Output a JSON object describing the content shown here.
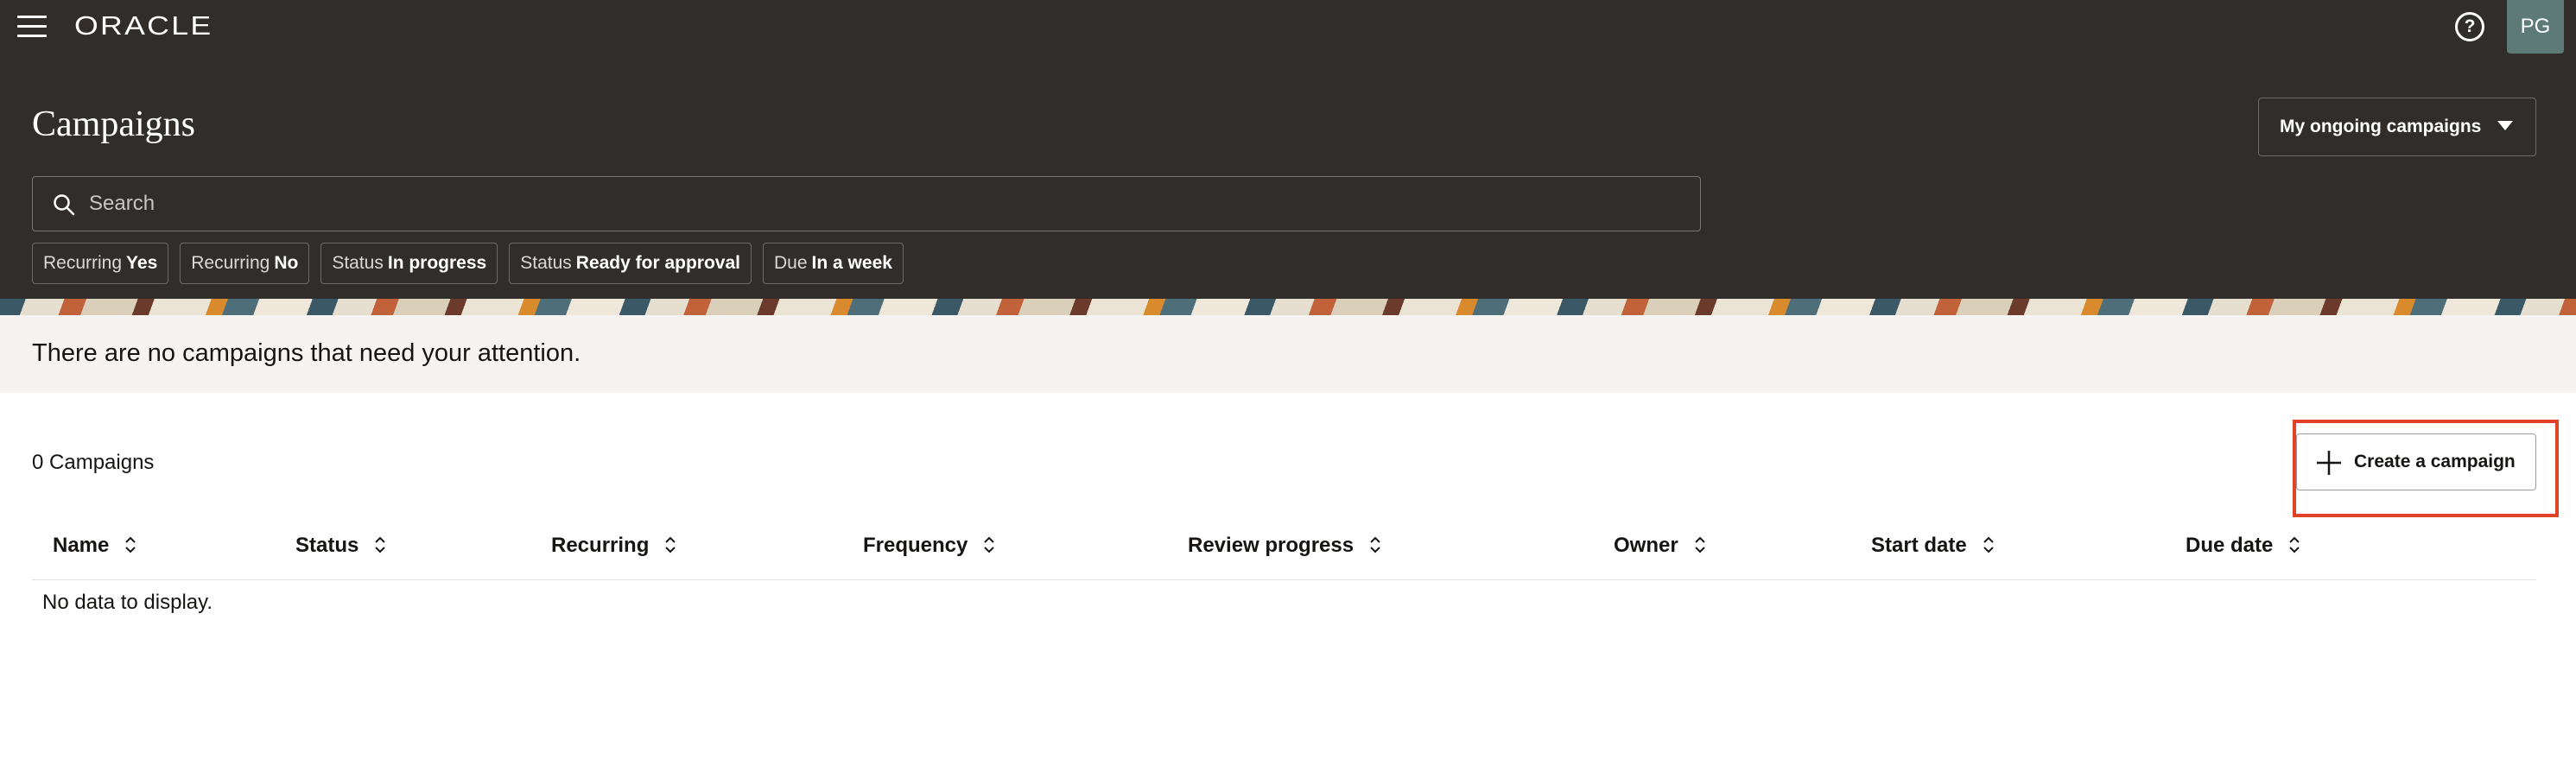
{
  "header": {
    "logo_text": "ORACLE",
    "avatar_initials": "PG",
    "title": "Campaigns",
    "view_select": "My ongoing campaigns"
  },
  "search": {
    "placeholder": "Search"
  },
  "filters": [
    {
      "label": "Recurring",
      "value": "Yes"
    },
    {
      "label": "Recurring",
      "value": "No"
    },
    {
      "label": "Status",
      "value": "In progress"
    },
    {
      "label": "Status",
      "value": "Ready for approval"
    },
    {
      "label": "Due",
      "value": "In a week"
    }
  ],
  "notice": "There are no campaigns that need your attention.",
  "list": {
    "count_label": "0 Campaigns",
    "create_label": "Create a campaign",
    "columns": [
      "Name",
      "Status",
      "Recurring",
      "Frequency",
      "Review progress",
      "Owner",
      "Start date",
      "Due date"
    ],
    "empty_text": "No data to display."
  },
  "colors": {
    "header_bg": "#312d2a",
    "notice_bg": "#f5f4f2",
    "highlight": "#e2422a"
  }
}
